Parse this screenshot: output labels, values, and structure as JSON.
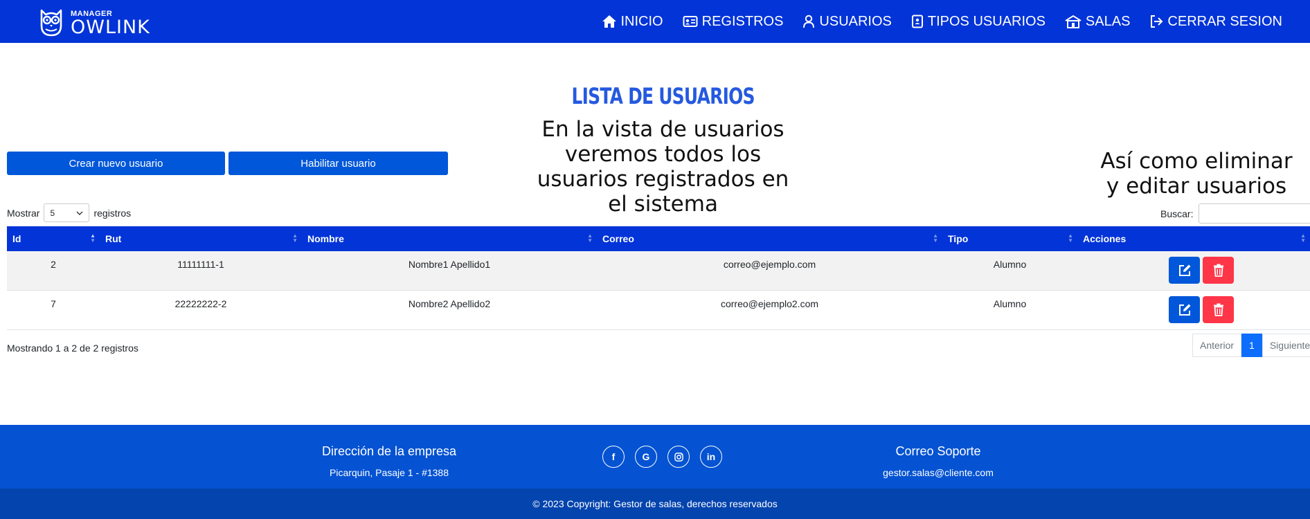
{
  "brand": {
    "small": "MANAGER",
    "big": "OWLINK",
    "logo_icon": "owl-icon"
  },
  "nav": [
    {
      "label": "INICIO",
      "icon": "home-icon"
    },
    {
      "label": "REGISTROS",
      "icon": "id-card-icon"
    },
    {
      "label": "USUARIOS",
      "icon": "user-icon"
    },
    {
      "label": "TIPOS USUARIOS",
      "icon": "contact-book-icon"
    },
    {
      "label": "SALAS",
      "icon": "building-icon"
    },
    {
      "label": "CERRAR SESION",
      "icon": "logout-icon"
    }
  ],
  "page": {
    "title": "LISTA DE USUARIOS"
  },
  "notes": {
    "left": "En la vista de usuarios veremos todos los usuarios registrados en el sistema",
    "right": "Así como eliminar y editar usuarios"
  },
  "actions": {
    "create": "Crear nuevo usuario",
    "enable": "Habilitar usuario"
  },
  "length": {
    "prefix": "Mostrar",
    "value": "5",
    "suffix": "registros"
  },
  "search": {
    "label": "Buscar:",
    "value": ""
  },
  "table": {
    "columns": [
      "Id",
      "Rut",
      "Nombre",
      "Correo",
      "Tipo",
      "Acciones"
    ],
    "rows": [
      {
        "id": "2",
        "rut": "11111111-1",
        "nombre": "Nombre1 Apellido1",
        "correo": "correo@ejemplo.com",
        "tipo": "Alumno"
      },
      {
        "id": "7",
        "rut": "22222222-2",
        "nombre": "Nombre2 Apellido2",
        "correo": "correo@ejemplo2.com",
        "tipo": "Alumno"
      }
    ]
  },
  "info": "Mostrando 1 a 2 de 2 registros",
  "pagination": {
    "prev": "Anterior",
    "current": "1",
    "next": "Siguiente"
  },
  "footer": {
    "address_title": "Dirección de la empresa",
    "address": "Picarquin, Pasaje 1 - #1388",
    "support_title": "Correo Soporte",
    "support_email": "gestor.salas@cliente.com",
    "socials": [
      "facebook-icon",
      "google-icon",
      "instagram-icon",
      "linkedin-icon"
    ],
    "copyright": "© 2023 Copyright: Gestor de salas, derechos reservados"
  },
  "colors": {
    "navbar": "#0234d8",
    "primary": "#0057d9",
    "danger": "#ff3548",
    "title": "#2559df",
    "footer": "#0553d2",
    "footer_bottom": "#0444ae"
  }
}
